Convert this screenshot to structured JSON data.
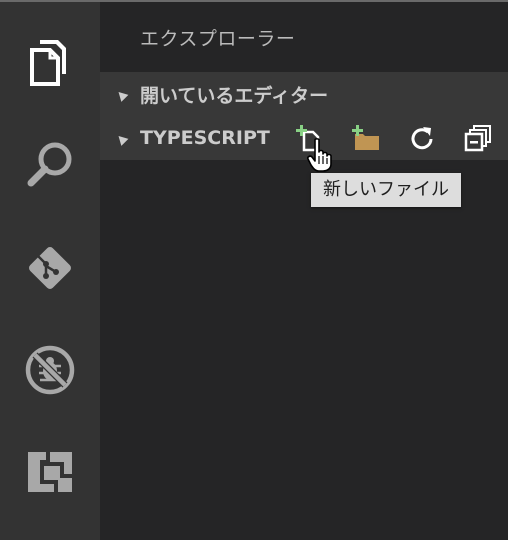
{
  "activity_bar": {
    "items": [
      {
        "name": "explorer",
        "icon": "files-icon",
        "active": true
      },
      {
        "name": "search",
        "icon": "search-icon",
        "active": false
      },
      {
        "name": "git",
        "icon": "git-icon",
        "active": false
      },
      {
        "name": "debug",
        "icon": "debug-icon",
        "active": false
      },
      {
        "name": "extensions",
        "icon": "extensions-icon",
        "active": false
      }
    ]
  },
  "sidebar": {
    "title": "エクスプローラー",
    "sections": [
      {
        "label": "開いているエディター",
        "expanded": true
      },
      {
        "label": "TYPESCRIPT",
        "expanded": true
      }
    ],
    "actions": [
      {
        "name": "new-file",
        "icon": "new-file-icon"
      },
      {
        "name": "new-folder",
        "icon": "new-folder-icon"
      },
      {
        "name": "refresh",
        "icon": "refresh-icon"
      },
      {
        "name": "collapse-all",
        "icon": "collapse-all-icon"
      }
    ]
  },
  "tooltip": {
    "text": "新しいファイル"
  },
  "colors": {
    "activity_bar_bg": "#333333",
    "sidebar_bg": "#252526",
    "section_header_bg": "#383838",
    "icon_active": "#ffffff",
    "icon_inactive": "#a8a8a8",
    "add_green": "#89d185",
    "folder_tan": "#c09553",
    "tooltip_bg": "#dddddd"
  }
}
